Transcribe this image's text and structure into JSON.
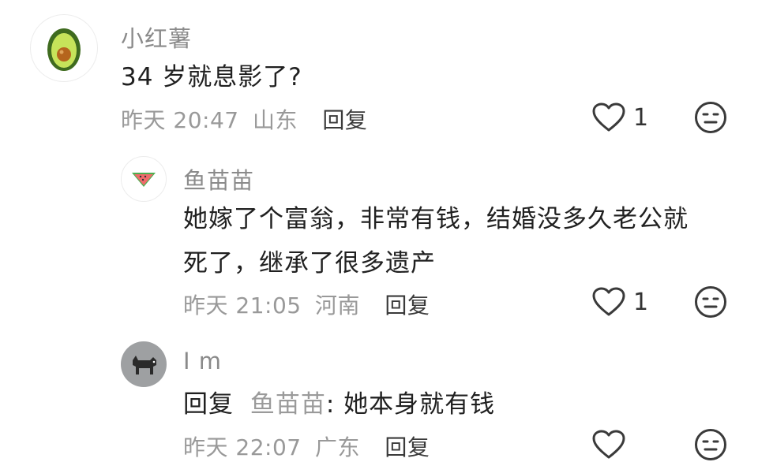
{
  "comments": [
    {
      "author": "小红薯",
      "text": "34 岁就息影了?",
      "time": "昨天 20:47",
      "location": "山东",
      "reply_label": "回复",
      "likes": "1",
      "avatar_icon": "avocado-icon"
    },
    {
      "author": "鱼苗苗",
      "text_line1": "她嫁了个富翁，非常有钱，结婚没多久老公就",
      "text_line2": "死了，继承了很多遗产",
      "time": "昨天 21:05",
      "location": "河南",
      "reply_label": "回复",
      "likes": "1",
      "avatar_icon": "watermelon-icon"
    },
    {
      "author": "I m",
      "reply_prefix": "回复",
      "reply_to": "鱼苗苗",
      "text": ": 她本身就有钱",
      "time": "昨天 22:07",
      "location": "广东",
      "reply_label": "回复",
      "likes": "",
      "avatar_icon": "dog-icon"
    }
  ]
}
